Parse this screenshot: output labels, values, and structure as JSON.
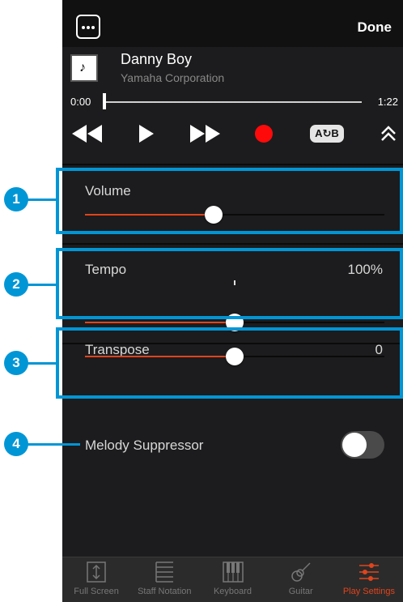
{
  "header": {
    "done_label": "Done"
  },
  "song": {
    "title": "Danny Boy",
    "artist": "Yamaha Corporation",
    "art_glyph": "♪"
  },
  "playback": {
    "time_start": "0:00",
    "time_end": "1:22",
    "progress": 0.0,
    "ab_label": "A↻B"
  },
  "settings": {
    "volume": {
      "label": "Volume",
      "level": 0.43
    },
    "tempo": {
      "label": "Tempo",
      "value": "100%",
      "level": 0.5
    },
    "transpose": {
      "label": "Transpose",
      "value": "0",
      "level": 0.5
    },
    "melody": {
      "label": "Melody Suppressor",
      "enabled": false
    }
  },
  "callouts": [
    "1",
    "2",
    "3",
    "4"
  ],
  "tabs": [
    {
      "label": "Full Screen",
      "icon": "full-screen-icon",
      "active": false
    },
    {
      "label": "Staff Notation",
      "icon": "staff-notation-icon",
      "active": false
    },
    {
      "label": "Keyboard",
      "icon": "keyboard-icon",
      "active": false
    },
    {
      "label": "Guitar",
      "icon": "guitar-icon",
      "active": false
    },
    {
      "label": "Play Settings",
      "icon": "sliders-icon",
      "active": true
    }
  ],
  "colors": {
    "accent": "#e0441c",
    "callout": "#0096d6",
    "record": "#ff0a0a"
  }
}
